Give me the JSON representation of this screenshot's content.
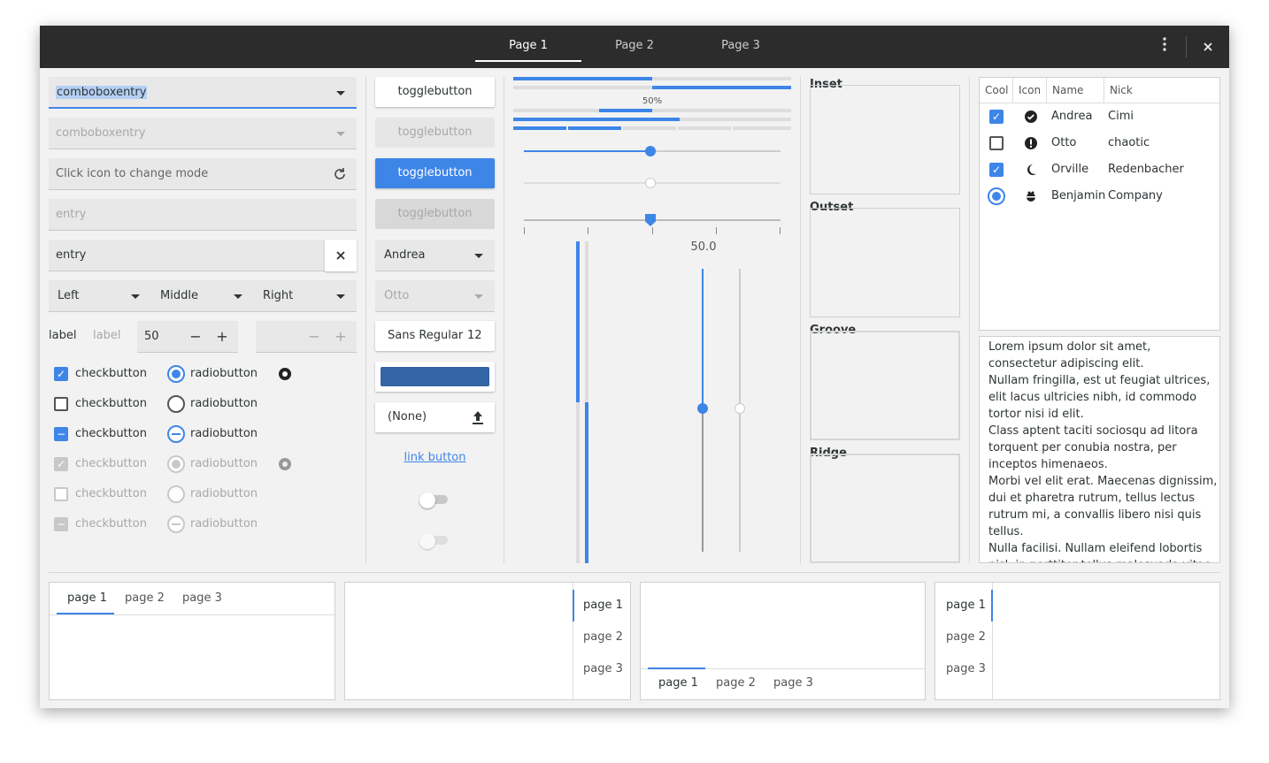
{
  "headerbar": {
    "tabs": [
      "Page 1",
      "Page 2",
      "Page 3"
    ],
    "menu_icon": "kebab-menu-icon",
    "close_icon": "close-icon"
  },
  "col1": {
    "combo1": "comboboxentry",
    "combo2": "comboboxentry",
    "entry_placeholder": "Click icon to change mode",
    "entry_disabled": "entry",
    "entry": "entry",
    "combos": [
      "Left",
      "Middle",
      "Right"
    ],
    "label1": "label",
    "label2": "label",
    "spin_value": "50",
    "minus": "−",
    "plus": "+",
    "checks": [
      "checkbutton",
      "checkbutton",
      "checkbutton",
      "checkbutton",
      "checkbutton",
      "checkbutton"
    ],
    "radios": [
      "radiobutton",
      "radiobutton",
      "radiobutton",
      "radiobutton",
      "radiobutton",
      "radiobutton"
    ]
  },
  "col2": {
    "toggles": [
      "togglebutton",
      "togglebutton",
      "togglebutton",
      "togglebutton"
    ],
    "combo_andrea": "Andrea",
    "combo_otto": "Otto",
    "font_name": "Sans Regular",
    "font_size": "12",
    "color_value": "#3465a4",
    "file_none": "(None)",
    "link": "link button",
    "switch1_on": false,
    "switch2_on": false
  },
  "col3": {
    "progress_label": "50%",
    "progress_values": [
      0.5,
      0.5,
      0.5,
      0.6
    ],
    "scale_values": [
      0.5,
      0.5,
      0.5
    ],
    "vscale_label": "50.0",
    "vscale_value": 0.5
  },
  "frames": [
    "Inset",
    "Outset",
    "Groove",
    "Ridge"
  ],
  "tree": {
    "columns": [
      "Cool",
      "Icon",
      "Name",
      "Nick"
    ],
    "rows": [
      {
        "cool": "checked",
        "icon": "check-circle-icon",
        "name": "Andrea",
        "nick": "Cimi"
      },
      {
        "cool": "unchecked",
        "icon": "exclamation-circle-icon",
        "name": "Otto",
        "nick": "chaotic"
      },
      {
        "cool": "checked",
        "icon": "moon-icon",
        "name": "Orville",
        "nick": "Redenbacher"
      },
      {
        "cool": "radio",
        "icon": "bug-icon",
        "name": "Benjamin",
        "nick": "Company"
      }
    ]
  },
  "textview": [
    "Lorem ipsum dolor sit amet,",
    "consectetur adipiscing elit.",
    "Nullam fringilla, est ut feugiat ultrices,",
    "elit lacus ultricies nibh, id commodo",
    "tortor nisi id elit.",
    "Class aptent taciti sociosqu ad litora",
    "torquent per conubia nostra, per",
    "inceptos himenaeos.",
    "Morbi vel elit erat. Maecenas dignissim,",
    "dui et pharetra rutrum, tellus lectus",
    "rutrum mi, a convallis libero nisi quis",
    "tellus.",
    "Nulla facilisi. Nullam eleifend lobortis",
    "nisl, in porttitor tellus malesuada vitae."
  ],
  "notebooks": [
    "page 1",
    "page 2",
    "page 3"
  ],
  "colors": {
    "accent": "#3e85e8",
    "header": "#2c2c2c"
  }
}
